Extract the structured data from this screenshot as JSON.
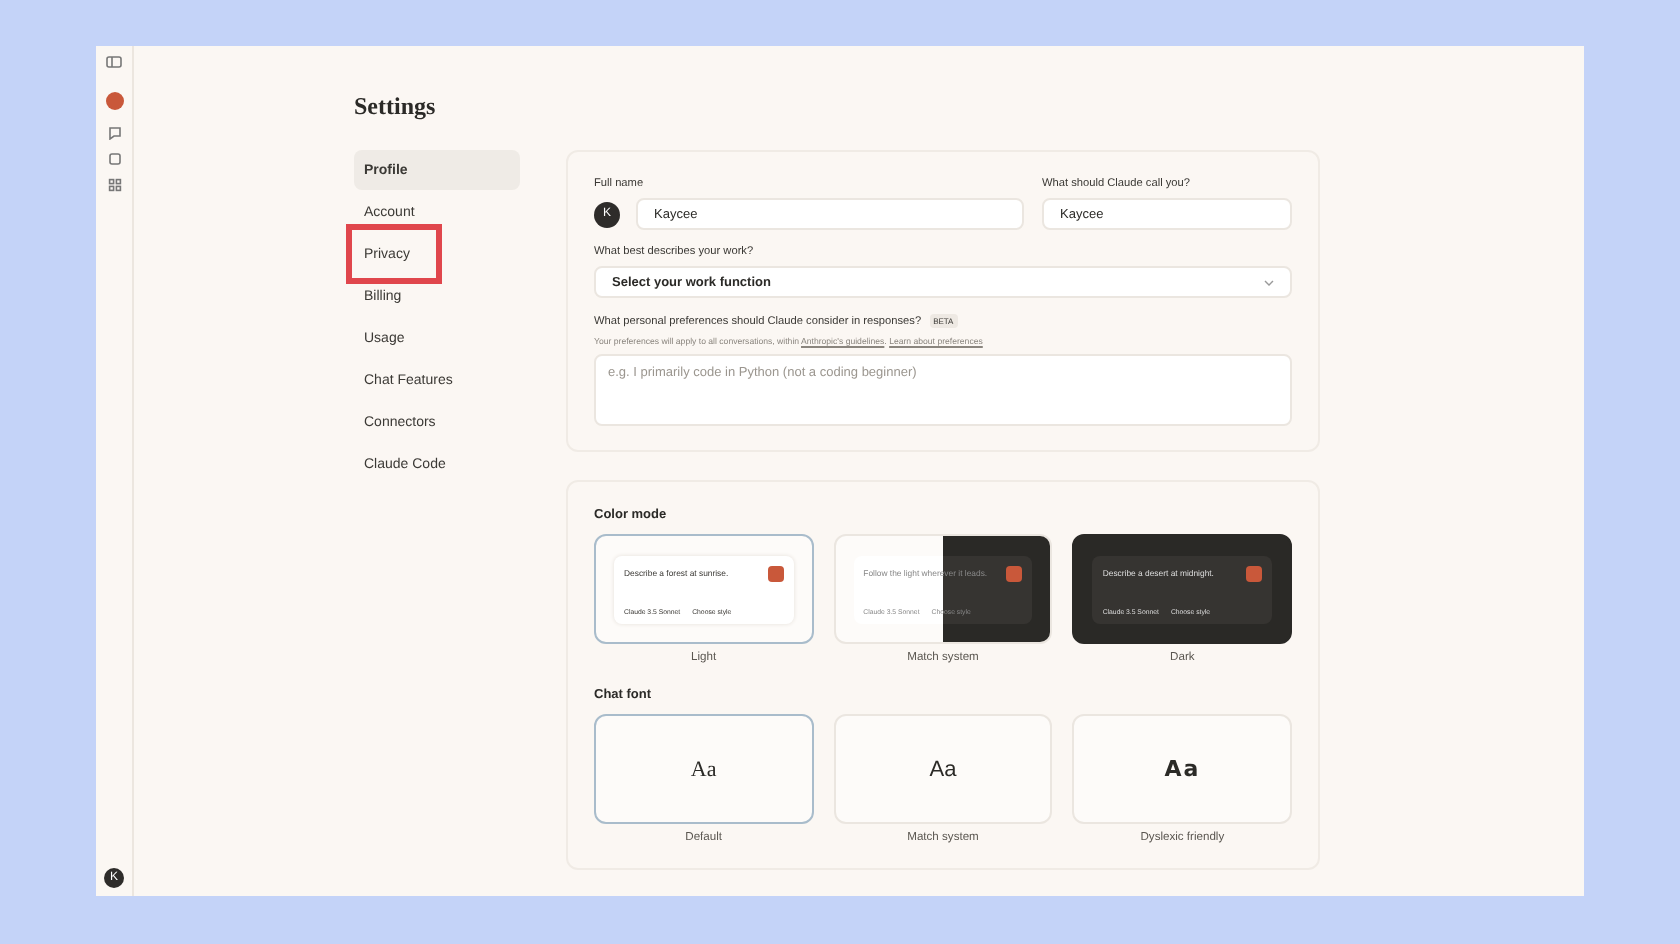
{
  "rail": {
    "avatar": "K"
  },
  "title": "Settings",
  "nav": [
    {
      "label": "Profile",
      "selected": true,
      "highlighted": false
    },
    {
      "label": "Account",
      "selected": false,
      "highlighted": false
    },
    {
      "label": "Privacy",
      "selected": false,
      "highlighted": true
    },
    {
      "label": "Billing",
      "selected": false,
      "highlighted": false
    },
    {
      "label": "Usage",
      "selected": false,
      "highlighted": false
    },
    {
      "label": "Chat Features",
      "selected": false,
      "highlighted": false
    },
    {
      "label": "Connectors",
      "selected": false,
      "highlighted": false
    },
    {
      "label": "Claude Code",
      "selected": false,
      "highlighted": false
    }
  ],
  "profile": {
    "full_name": {
      "label": "Full name",
      "avatar": "K",
      "value": "Kaycee"
    },
    "call_name": {
      "label": "What should Claude call you?",
      "value": "Kaycee"
    },
    "work": {
      "label": "What best describes your work?",
      "value": "Select your work function"
    },
    "preferences": {
      "label": "What personal preferences should Claude consider in responses?",
      "badge": "BETA",
      "hint": "Your preferences will apply to all conversations, within ",
      "link1": "Anthropic's guidelines",
      "sep": ". ",
      "link2": "Learn about preferences",
      "placeholder": "e.g. I primarily code in Python (not a coding beginner)"
    }
  },
  "color_mode": {
    "heading": "Color mode",
    "options": [
      {
        "kind": "light",
        "label": "Light",
        "prompt": "Describe a forest at sunrise.",
        "model": "Claude 3.5 Sonnet",
        "style": "Choose style",
        "selected": true
      },
      {
        "kind": "split",
        "label": "Match system",
        "prompt": "Follow the light wherever it leads.",
        "model": "Claude 3.5 Sonnet",
        "style": "Choose style",
        "selected": false
      },
      {
        "kind": "dark",
        "label": "Dark",
        "prompt": "Describe a desert at midnight.",
        "model": "Claude 3.5 Sonnet",
        "style": "Choose style",
        "selected": false
      }
    ]
  },
  "chat_font": {
    "heading": "Chat font",
    "options": [
      {
        "kind": "serif",
        "sample": "Aa",
        "label": "Default",
        "selected": true
      },
      {
        "kind": "system",
        "sample": "Aa",
        "label": "Match system",
        "selected": false
      },
      {
        "kind": "dyslexic",
        "sample": "Aa",
        "label": "Dyslexic friendly",
        "selected": false
      }
    ]
  }
}
